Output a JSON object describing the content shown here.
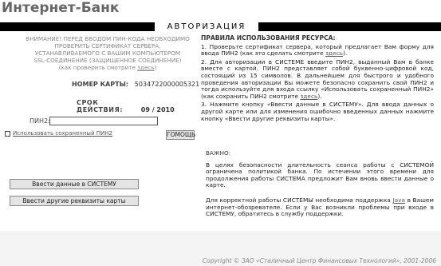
{
  "brand": "Интернет-Банк",
  "auth_title": "АВТОРИЗАЦИЯ",
  "warning": {
    "line1": "ВНИМАНИЕ! ПЕРЕД ВВОДОМ ПИН-КОДА НЕОБХОДИМО",
    "line2": "ПРОВЕРИТЬ СЕРТИФИКАТ СЕРВЕРА,",
    "line3": "УСТАНАВЛИВАЕМОГО С ВАШИМ КОМПЬЮТЕРОМ",
    "line4": "SSL-СОЕДИНЕНИЕ (ЗАЩИЩЕННОЕ СОЕДИНЕНИЕ)",
    "line5_prefix": "(как проверить смотрите ",
    "line5_link": "здесь",
    "line5_suffix": ")"
  },
  "card": {
    "label": "НОМЕР КАРТЫ:",
    "value": "5034722000005321"
  },
  "expiry": {
    "label": "СРОК ДЕЙСТВИЯ:",
    "value": "09 / 2010"
  },
  "pin": {
    "label": "ПИН2:",
    "value": "",
    "save_label": "Использовать сохраненный ПИН2",
    "ok_label": "ГОМОЩЬ"
  },
  "buttons": {
    "enter": "Ввести данные в СИСТЕМУ",
    "other": "Ввести другие реквизиты карты"
  },
  "rules": {
    "title": "ПРАВИЛА ИСПОЛЬЗОВАНИЯ РЕСУРСА:",
    "item1_prefix": "1.  Проверьте сертификат сервера, который предлагает Вам форму для ввода ПИН2 (как это сделать смотрите ",
    "item1_link": "здесь",
    "item1_suffix": ").",
    "item2_prefix": "2.  Для авторизации в СИСТЕМЕ введите ПИН2, выданный Вам в банке вместе с картой. ПИН2 представляет собой буквенно-цифровой код, состоящий из 15 символов. В дальнейшем для быстрого и удобного проведения авторизации Вы можете безопасно сохранить свой ПИН2 и тогда используйте для входа ссылку «Использовать сохраненный ПИН2» (как сохранить ПИН2 смотрите ",
    "item2_link": "здесь",
    "item2_suffix": ").",
    "item3": "3.  Нажмите кнопку «Ввести данные в СИСТЕМУ». Для ввода данных о другой карте или для изменения ошибочно введенных данных нажмите кнопку «Ввести другие реквизиты карты»."
  },
  "notes": {
    "title": "ВАЖНО:",
    "p1": "В целях безопасности длительность сеанса работы с СИСТЕМОЙ ограничена политикой банка. По истечении этого времени для продолжения работы СИСТЕМА предложит Вам вновь ввести данные о карте.",
    "p2_prefix": "Для корректной работы СИСТЕМЫ необходима поддержка ",
    "p2_link": "Java",
    "p2_suffix": " в Вашем интернет-обозревателе. Если у Вас возникли проблемы при входе в СИСТЕМУ, обратитесь в службу поддержки."
  },
  "footer": "Copyright © ЗАО «Сталичный Центр Финансовых Технологий», 2001-2006"
}
